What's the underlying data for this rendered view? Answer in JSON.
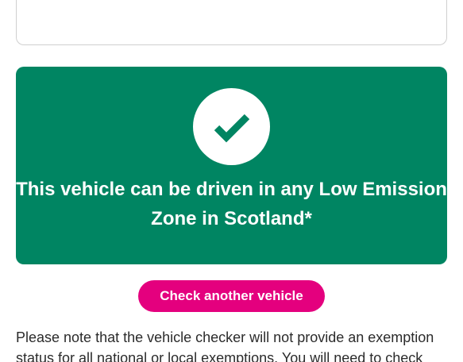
{
  "result": {
    "message": "This vehicle can be driven in any Low Emission Zone in Scotland*",
    "icon": "check-icon",
    "panel_color": "#008562"
  },
  "actions": {
    "check_another_label": "Check another vehicle",
    "button_color": "#e4007e"
  },
  "note": {
    "text": "Please note that the vehicle checker will not provide an exemption status for all national or local exemptions. You will need to check"
  }
}
